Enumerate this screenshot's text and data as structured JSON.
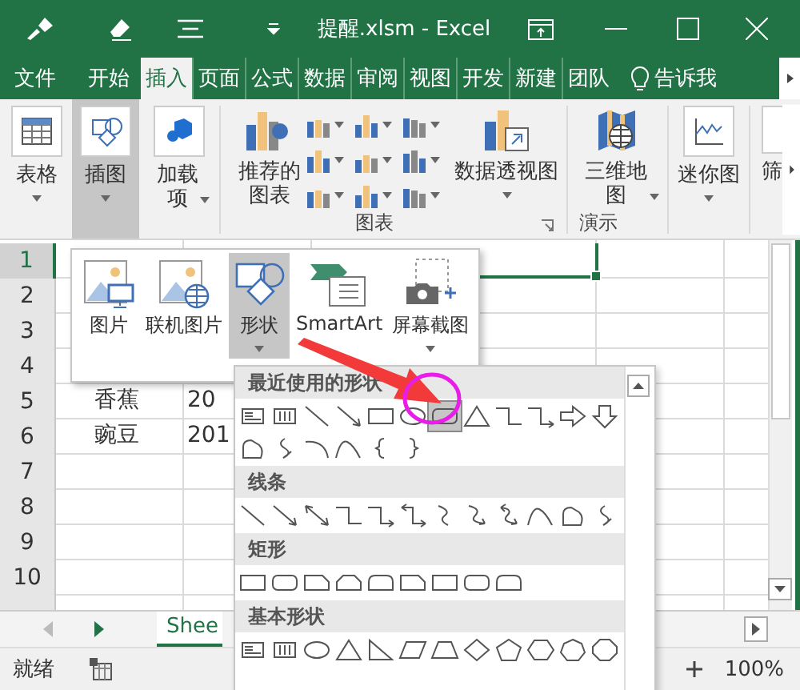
{
  "window": {
    "title": "提醒.xlsm - Excel"
  },
  "ribbon_tabs": [
    {
      "label": "文件",
      "selected": false
    },
    {
      "label": "开始",
      "selected": false
    },
    {
      "label": "插入",
      "selected": true
    },
    {
      "label": "页面",
      "selected": false
    },
    {
      "label": "公式",
      "selected": false
    },
    {
      "label": "数据",
      "selected": false
    },
    {
      "label": "审阅",
      "selected": false
    },
    {
      "label": "视图",
      "selected": false
    },
    {
      "label": "开发",
      "selected": false
    },
    {
      "label": "新建",
      "selected": false
    },
    {
      "label": "团队",
      "selected": false
    }
  ],
  "tell_me": {
    "label": "告诉我"
  },
  "ribbon_buttons": [
    {
      "label": "表格",
      "pressed": false,
      "dropdown": true
    },
    {
      "label": "插图",
      "pressed": true,
      "dropdown": true
    },
    {
      "label": "加载项",
      "pressed": false,
      "dropdown": true
    },
    {
      "label": "推荐的图表",
      "pressed": false,
      "dropdown": false
    },
    {
      "label": "数据透视图",
      "pressed": false,
      "dropdown": true
    },
    {
      "label": "三维地图",
      "pressed": false,
      "dropdown": true
    },
    {
      "label": "迷你图",
      "pressed": false,
      "dropdown": true
    },
    {
      "label": "筛",
      "pressed": false,
      "dropdown": false
    }
  ],
  "ribbon_groups": [
    "图表",
    "演示"
  ],
  "illustrations_menu": [
    {
      "label": "图片",
      "pressed": false,
      "dropdown": false
    },
    {
      "label": "联机图片",
      "pressed": false,
      "dropdown": false
    },
    {
      "label": "形状",
      "pressed": true,
      "dropdown": true
    },
    {
      "label": "SmartArt",
      "pressed": false,
      "dropdown": false
    },
    {
      "label": "屏幕截图",
      "pressed": false,
      "dropdown": true
    }
  ],
  "shapes_gallery": {
    "sections": [
      {
        "title": "最近使用的形状",
        "shapes": [
          {
            "kind": "text-box",
            "selected": false
          },
          {
            "kind": "vertical-text-box",
            "selected": false
          },
          {
            "kind": "line",
            "selected": false
          },
          {
            "kind": "arrow",
            "selected": false
          },
          {
            "kind": "rectangle",
            "selected": false
          },
          {
            "kind": "oval",
            "selected": false
          },
          {
            "kind": "rounded-rectangle",
            "selected": true
          },
          {
            "kind": "triangle",
            "selected": false
          },
          {
            "kind": "elbow-connector",
            "selected": false
          },
          {
            "kind": "elbow-arrow",
            "selected": false
          },
          {
            "kind": "right-arrow",
            "selected": false
          },
          {
            "kind": "down-arrow",
            "selected": false
          },
          {
            "kind": "freeform",
            "selected": false
          },
          {
            "kind": "scribble",
            "selected": false
          },
          {
            "kind": "arc",
            "selected": false
          },
          {
            "kind": "curve",
            "selected": false
          },
          {
            "kind": "left-brace",
            "selected": false
          },
          {
            "kind": "right-brace",
            "selected": false
          }
        ]
      },
      {
        "title": "线条",
        "shapes": [
          {
            "kind": "line",
            "selected": false
          },
          {
            "kind": "arrow",
            "selected": false
          },
          {
            "kind": "double-arrow",
            "selected": false
          },
          {
            "kind": "elbow-connector",
            "selected": false
          },
          {
            "kind": "elbow-arrow",
            "selected": false
          },
          {
            "kind": "elbow-double-arrow",
            "selected": false
          },
          {
            "kind": "curved-connector",
            "selected": false
          },
          {
            "kind": "curved-arrow",
            "selected": false
          },
          {
            "kind": "curved-double-arrow",
            "selected": false
          },
          {
            "kind": "curve",
            "selected": false
          },
          {
            "kind": "freeform",
            "selected": false
          },
          {
            "kind": "scribble",
            "selected": false
          }
        ]
      },
      {
        "title": "矩形",
        "shapes": [
          {
            "kind": "rectangle",
            "selected": false
          },
          {
            "kind": "rounded-rectangle",
            "selected": false
          },
          {
            "kind": "snipped-rectangle",
            "selected": false
          },
          {
            "kind": "snipped-top-rectangle",
            "selected": false
          },
          {
            "kind": "round-top-rectangle",
            "selected": false
          },
          {
            "kind": "snipped-rectangle",
            "selected": false
          },
          {
            "kind": "rectangle",
            "selected": false
          },
          {
            "kind": "rounded-rectangle",
            "selected": false
          },
          {
            "kind": "round-top-rectangle",
            "selected": false
          }
        ]
      },
      {
        "title": "基本形状",
        "shapes": [
          {
            "kind": "text-box",
            "selected": false
          },
          {
            "kind": "vertical-text-box",
            "selected": false
          },
          {
            "kind": "oval",
            "selected": false
          },
          {
            "kind": "triangle",
            "selected": false
          },
          {
            "kind": "right-triangle",
            "selected": false
          },
          {
            "kind": "parallelogram",
            "selected": false
          },
          {
            "kind": "trapezoid",
            "selected": false
          },
          {
            "kind": "diamond",
            "selected": false
          },
          {
            "kind": "pentagon",
            "selected": false
          },
          {
            "kind": "hexagon",
            "selected": false
          },
          {
            "kind": "heptagon",
            "selected": false
          },
          {
            "kind": "octagon",
            "selected": false
          }
        ]
      }
    ]
  },
  "sheet": {
    "rows": [
      {
        "number": "1",
        "selected": true
      },
      {
        "number": "2",
        "selected": false
      },
      {
        "number": "3",
        "selected": false
      },
      {
        "number": "4",
        "selected": false
      },
      {
        "number": "5",
        "selected": false,
        "cells": [
          "香蕉",
          "20"
        ]
      },
      {
        "number": "6",
        "selected": false,
        "cells": [
          "豌豆",
          "201"
        ]
      },
      {
        "number": "7",
        "selected": false
      },
      {
        "number": "8",
        "selected": false
      },
      {
        "number": "9",
        "selected": false
      },
      {
        "number": "10",
        "selected": false
      }
    ]
  },
  "sheet_tabs": [
    {
      "label": "Shee",
      "selected": true
    }
  ],
  "status_bar": {
    "status": "就绪",
    "zoom": "100%"
  },
  "annotations": [
    {
      "kind": "arrow"
    },
    {
      "kind": "circle"
    }
  ]
}
